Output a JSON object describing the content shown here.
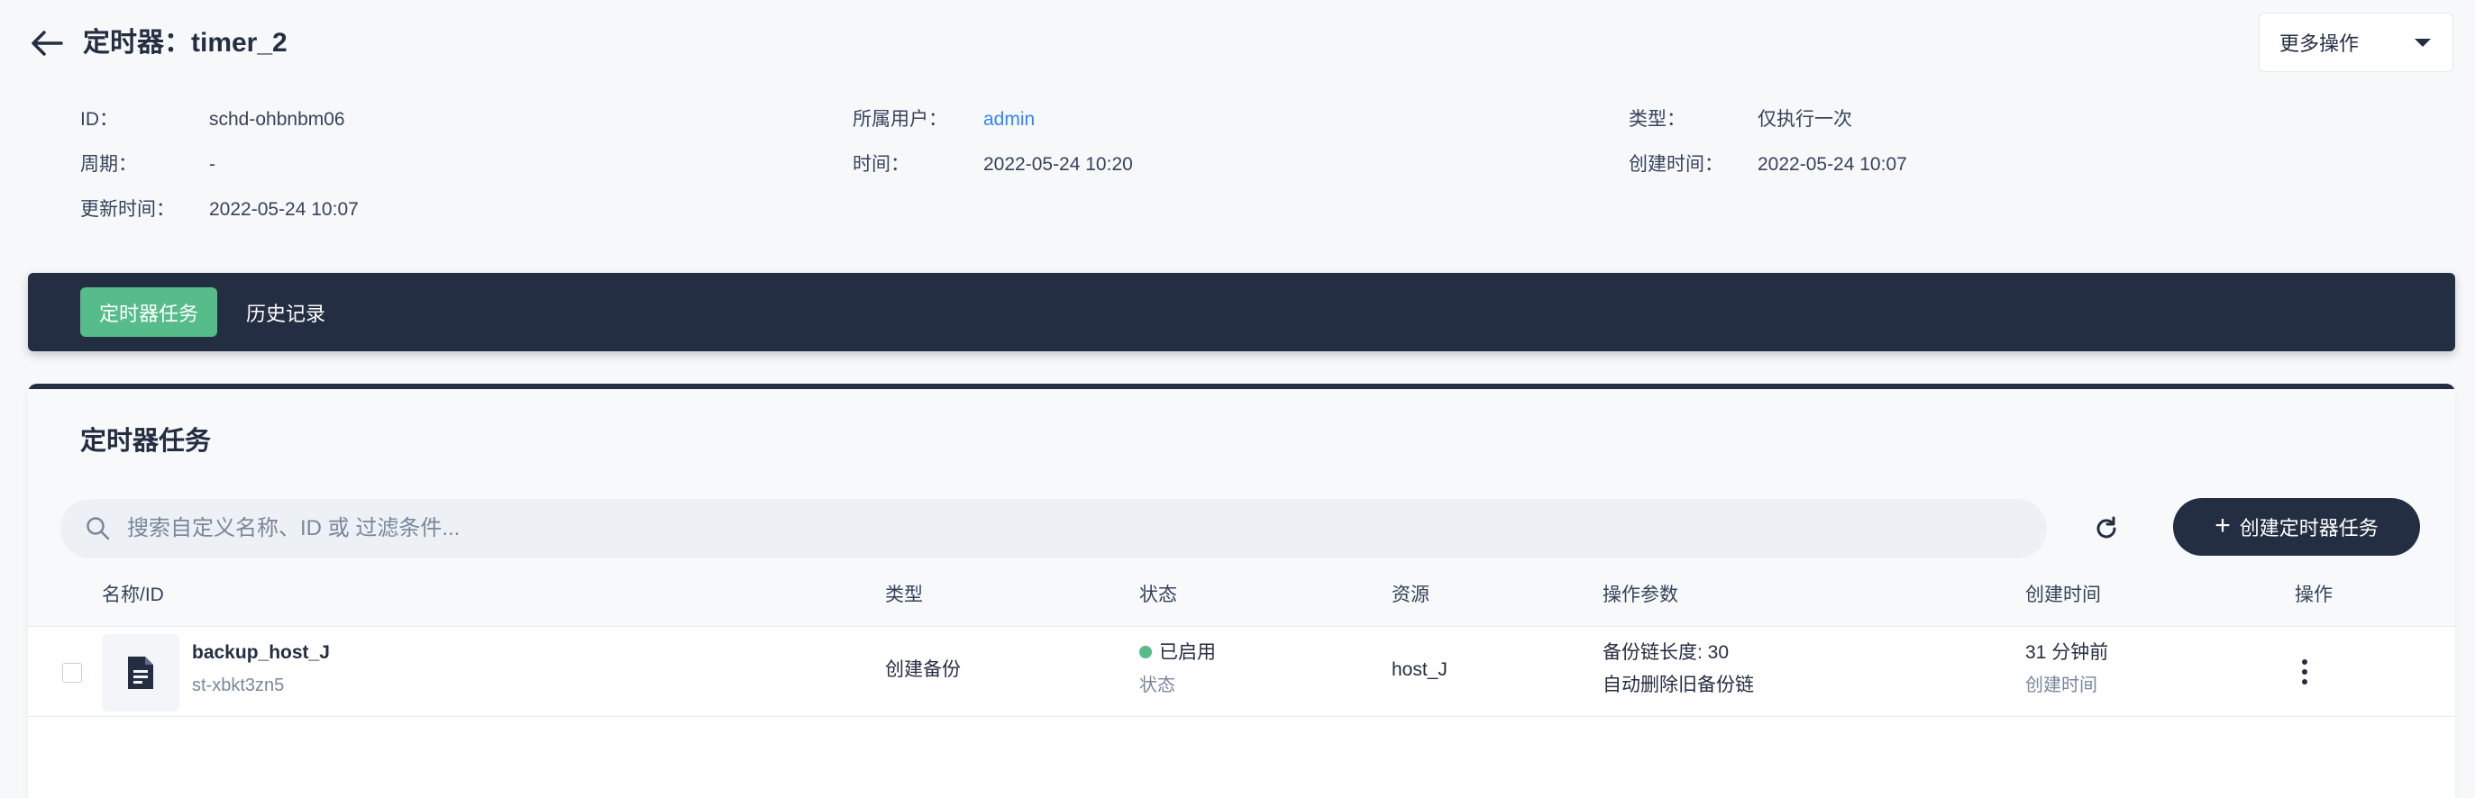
{
  "header": {
    "title": "定时器：timer_2",
    "more_actions": "更多操作"
  },
  "details": {
    "id_label": "ID：",
    "id_value": "schd-ohbnbm06",
    "owner_label": "所属用户：",
    "owner_value": "admin",
    "type_label": "类型：",
    "type_value": "仅执行一次",
    "period_label": "周期：",
    "period_value": "-",
    "time_label": "时间：",
    "time_value": "2022-05-24 10:20",
    "created_label": "创建时间：",
    "created_value": "2022-05-24 10:07",
    "updated_label": "更新时间：",
    "updated_value": "2022-05-24 10:07"
  },
  "tabs": [
    {
      "label": "定时器任务",
      "active": true
    },
    {
      "label": "历史记录",
      "active": false
    }
  ],
  "card": {
    "title": "定时器任务",
    "search_placeholder": "搜索自定义名称、ID 或 过滤条件...",
    "create_label": "创建定时器任务"
  },
  "table": {
    "columns": [
      "名称/ID",
      "类型",
      "状态",
      "资源",
      "操作参数",
      "创建时间",
      "操作"
    ],
    "rows": [
      {
        "name": "backup_host_J",
        "id": "st-xbkt3zn5",
        "type": "创建备份",
        "status": "已启用",
        "status_sub": "状态",
        "resource": "host_J",
        "param1": "备份链长度: 30",
        "param2": "自动删除旧备份链",
        "created": "31 分钟前",
        "created_sub": "创建时间"
      }
    ]
  },
  "colors": {
    "dark": "#242e42",
    "accent_green": "#55bc8a",
    "link_blue": "#3385ff"
  },
  "icons": {
    "back": "arrow-left-icon",
    "caret": "caret-down-icon",
    "search": "search-icon",
    "refresh": "refresh-icon",
    "add": "plus-icon",
    "row": "document-icon",
    "more": "more-vertical-icon"
  }
}
